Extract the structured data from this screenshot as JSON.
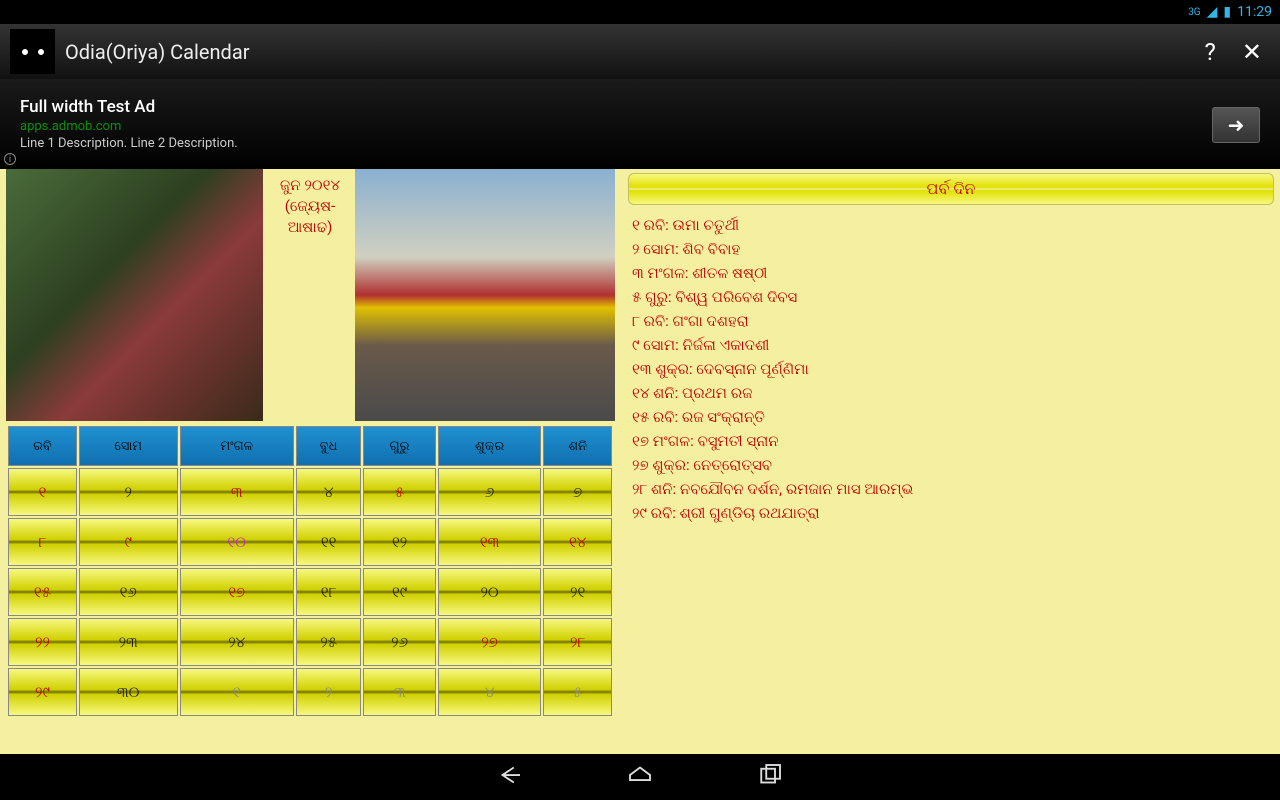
{
  "status": {
    "network": "3G",
    "time": "11:29"
  },
  "titlebar": {
    "title": "Odia(Oriya) Calendar",
    "help": "?",
    "close": "✕"
  },
  "ad": {
    "title": "Full width Test Ad",
    "url": "apps.admob.com",
    "desc": "Line 1 Description. Line 2 Description.",
    "arrow": "➜",
    "info": "i"
  },
  "month": {
    "line1": "ଜୁନ ୨୦୧୪",
    "line2": "(ଜ୍ୟେଷ-ଆଷାଢ)"
  },
  "weekdays": [
    "ରବି",
    "ସୋମ",
    "ମଂଗଳ",
    "ବୁଧ",
    "ଗୁରୁ",
    "ଶୁକ୍ର",
    "ଶନି"
  ],
  "weeks": [
    [
      {
        "d": "୧",
        "c": "fest"
      },
      {
        "d": "୨",
        "c": "norm"
      },
      {
        "d": "୩",
        "c": "fest"
      },
      {
        "d": "୪",
        "c": "norm"
      },
      {
        "d": "୫",
        "c": "fest"
      },
      {
        "d": "୬",
        "c": "norm"
      },
      {
        "d": "୭",
        "c": "norm"
      }
    ],
    [
      {
        "d": "୮",
        "c": "fest"
      },
      {
        "d": "୯",
        "c": "fest"
      },
      {
        "d": "୧୦",
        "c": "holi"
      },
      {
        "d": "୧୧",
        "c": "norm"
      },
      {
        "d": "୧୨",
        "c": "norm"
      },
      {
        "d": "୧୩",
        "c": "fest"
      },
      {
        "d": "୧୪",
        "c": "fest"
      }
    ],
    [
      {
        "d": "୧୫",
        "c": "fest"
      },
      {
        "d": "୧୬",
        "c": "norm"
      },
      {
        "d": "୧୭",
        "c": "fest"
      },
      {
        "d": "୧୮",
        "c": "norm"
      },
      {
        "d": "୧୯",
        "c": "norm"
      },
      {
        "d": "୨୦",
        "c": "norm"
      },
      {
        "d": "୨୧",
        "c": "norm"
      }
    ],
    [
      {
        "d": "୨୨",
        "c": "fest"
      },
      {
        "d": "୨୩",
        "c": "norm"
      },
      {
        "d": "୨୪",
        "c": "norm"
      },
      {
        "d": "୨୫",
        "c": "norm"
      },
      {
        "d": "୨୬",
        "c": "norm"
      },
      {
        "d": "୨୭",
        "c": "fest"
      },
      {
        "d": "୨୮",
        "c": "fest"
      }
    ],
    [
      {
        "d": "୨୯",
        "c": "fest"
      },
      {
        "d": "୩୦",
        "c": "norm"
      },
      {
        "d": "୧",
        "c": "fade"
      },
      {
        "d": "୨",
        "c": "fade"
      },
      {
        "d": "୩",
        "c": "fade"
      },
      {
        "d": "୪",
        "c": "fade"
      },
      {
        "d": "୫",
        "c": "fade"
      }
    ]
  ],
  "festivals": {
    "header": "ପର୍ବ ଦିନ",
    "items": [
      "୧ ରବି: ଉମା ଚତୁର୍ଥୀ",
      "୨ ସୋମ: ଶିବ ବିବାହ",
      "୩ ମଂଗଳ: ଶୀତଳ ଷଷ୍ଠୀ",
      "୫ ଗୁରୁ: ବିଶ୍ୱ ପରିବେଶ ଦିବସ",
      "୮ ରବି: ଗଂଗା ଦଶହରା",
      "୯ ସୋମ: ନିର୍ଜଳା ଏକାଦଶୀ",
      "୧୩ ଶୁକ୍ର: ଦେବସ୍ନାନ ପୂର୍ଣ୍ଣିମା",
      "୧୪ ଶନି: ପ୍ରଥମ ରଜ",
      "୧୫ ରବି: ରଜ ସଂକ୍ରାନ୍ତି",
      "୧୭ ମଂଗଳ: ବସୁମତୀ ସ୍ନାନ",
      "୨୭ ଶୁକ୍ର: ନେତ୍ରୋତ୍ସବ",
      "୨୮ ଶନି: ନବଯୌବନ ଦର୍ଶନ, ରମଜାନ ମାସ ଆରମ୍ଭ",
      "୨୯ ରବି: ଶ୍ରୀ ଗୁଣ୍ଡିଚା ରଥଯାତ୍ରା"
    ]
  }
}
